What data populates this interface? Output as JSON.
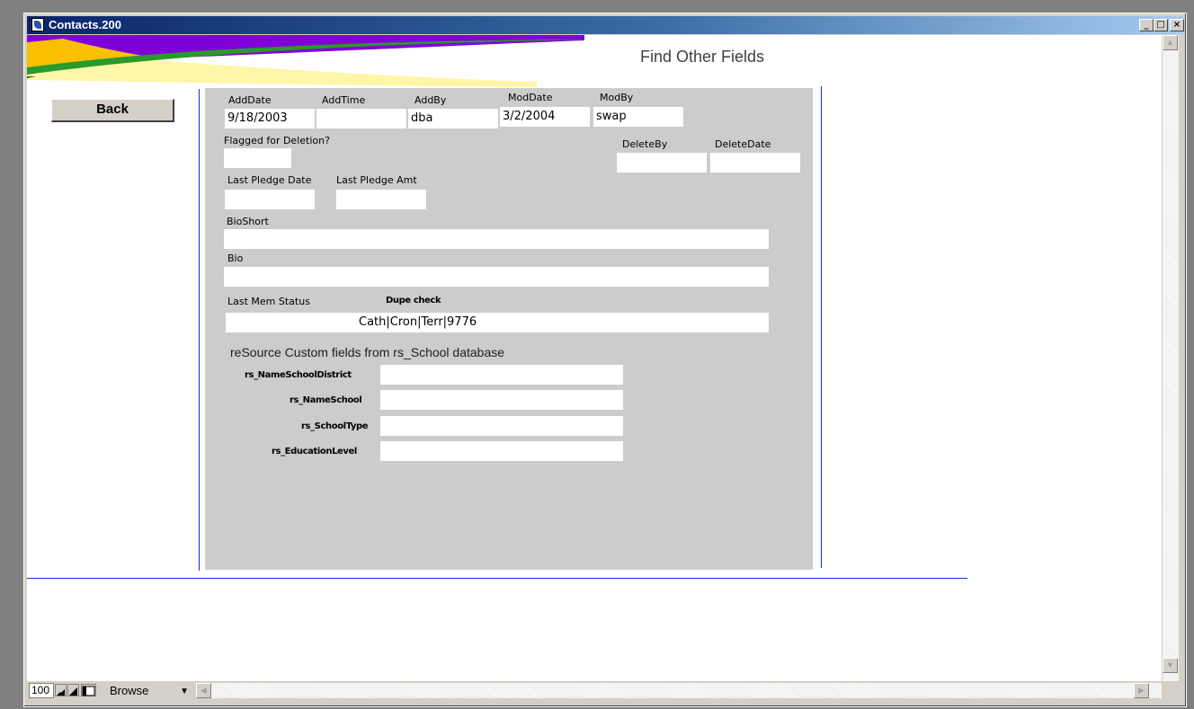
{
  "window": {
    "title": "Contacts.200",
    "min_label": "_",
    "max_label": "□",
    "close_label": "×"
  },
  "layout": {
    "title": "Find  Other Fields",
    "back_label": "Back"
  },
  "fields": {
    "add_date": {
      "label": "AddDate",
      "value": "9/18/2003"
    },
    "add_time": {
      "label": "AddTime",
      "value": ""
    },
    "add_by": {
      "label": "AddBy",
      "value": "dba"
    },
    "mod_date": {
      "label": "ModDate",
      "value": "3/2/2004"
    },
    "mod_by": {
      "label": "ModBy",
      "value": "swap"
    },
    "flagged": {
      "label": "Flagged for Deletion?",
      "value": ""
    },
    "delete_by": {
      "label": "DeleteBy",
      "value": ""
    },
    "delete_date": {
      "label": "DeleteDate",
      "value": ""
    },
    "last_pledge_date": {
      "label": "Last Pledge Date",
      "value": ""
    },
    "last_pledge_amt": {
      "label": "Last Pledge Amt",
      "value": ""
    },
    "bio_short": {
      "label": "BioShort",
      "value": ""
    },
    "bio": {
      "label": "Bio",
      "value": ""
    },
    "last_mem_status": {
      "label": "Last Mem Status",
      "value": ""
    },
    "dupe_check": {
      "label": "Dupe check",
      "value": "Cath|Cron|Terr|9776"
    }
  },
  "custom": {
    "heading": "reSource Custom fields from rs_School database",
    "name_school_district": {
      "label": "rs_NameSchoolDistrict",
      "value": ""
    },
    "name_school": {
      "label": "rs_NameSchool",
      "value": ""
    },
    "school_type": {
      "label": "rs_SchoolType",
      "value": ""
    },
    "education_level": {
      "label": "rs_EducationLevel",
      "value": ""
    }
  },
  "status": {
    "zoom": "100",
    "mode": "Browse"
  },
  "colors": {
    "title_start": "#0a246a",
    "title_end": "#a6caf0",
    "panel": "#cccccc",
    "guide_line": "#1030d0"
  }
}
